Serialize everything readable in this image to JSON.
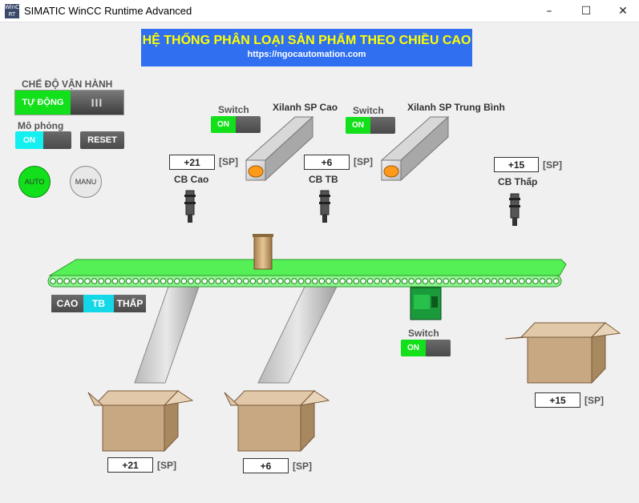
{
  "window": {
    "title": "SIMATIC WinCC Runtime Advanced",
    "icon_text": "WinCC RT",
    "controls": {
      "minimize": "–",
      "maximize": "☐",
      "close": "✕"
    }
  },
  "banner": {
    "title": "HỆ THỐNG PHÂN LOẠI SẢN PHẨM THEO CHIỀU CAO",
    "url": "https://ngocautomation.com"
  },
  "mode": {
    "label": "CHẾ ĐỘ VẬN HÀNH",
    "on_text": "TỰ ĐỘNG",
    "off_text": "III"
  },
  "simulation": {
    "label": "Mô phỏng",
    "on_text": "ON",
    "reset_label": "RESET"
  },
  "lamps": {
    "auto": "AUTO",
    "manu": "MANU"
  },
  "cylinders": [
    {
      "switch_label": "Switch",
      "switch_on": "ON",
      "name": "Xilanh SP Cao"
    },
    {
      "switch_label": "Switch",
      "switch_on": "ON",
      "name": "Xilanh SP Trung Bình"
    }
  ],
  "sensors": [
    {
      "name": "CB Cao",
      "count": "+21",
      "unit": "[SP]"
    },
    {
      "name": "CB TB",
      "count": "+6",
      "unit": "[SP]"
    },
    {
      "name": "CB Thấp",
      "count": "+15",
      "unit": "[SP]"
    }
  ],
  "selector": {
    "cao": "CAO",
    "tb": "TB",
    "thap": "THẤP",
    "selected": "TB"
  },
  "motor": {
    "switch_label": "Switch",
    "switch_on": "ON"
  },
  "boxes": [
    {
      "count": "+21",
      "unit": "[SP]"
    },
    {
      "count": "+6",
      "unit": "[SP]"
    },
    {
      "count": "+15",
      "unit": "[SP]"
    }
  ],
  "colors": {
    "banner_bg": "#2f6ff0",
    "banner_title": "#ffff00",
    "on_green": "#12e01a",
    "on_cyan": "#14f0f0",
    "conveyor": "#55f055",
    "box": "#c8a882"
  }
}
